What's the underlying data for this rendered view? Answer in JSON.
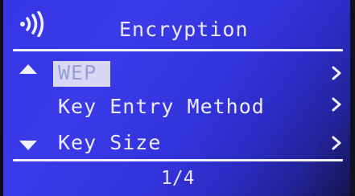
{
  "header": {
    "title": "Encryption",
    "icon": "wireless-signal-icon"
  },
  "menu": {
    "items": [
      {
        "label": "WEP",
        "selected": true,
        "icon": "chevron-right-icon"
      },
      {
        "label": "Key Entry Method",
        "selected": false,
        "icon": "chevron-right-icon"
      },
      {
        "label": "Key Size",
        "selected": false,
        "icon": "chevron-right-icon"
      }
    ],
    "scroll_up_icon": "triangle-up-icon",
    "scroll_down_icon": "triangle-down-icon"
  },
  "footer": {
    "page": "1/4"
  },
  "colors": {
    "background": "#3434de",
    "foreground": "#ecebff",
    "selection_bg": "#d9d8f4",
    "selection_fg": "#9a9ed8"
  }
}
